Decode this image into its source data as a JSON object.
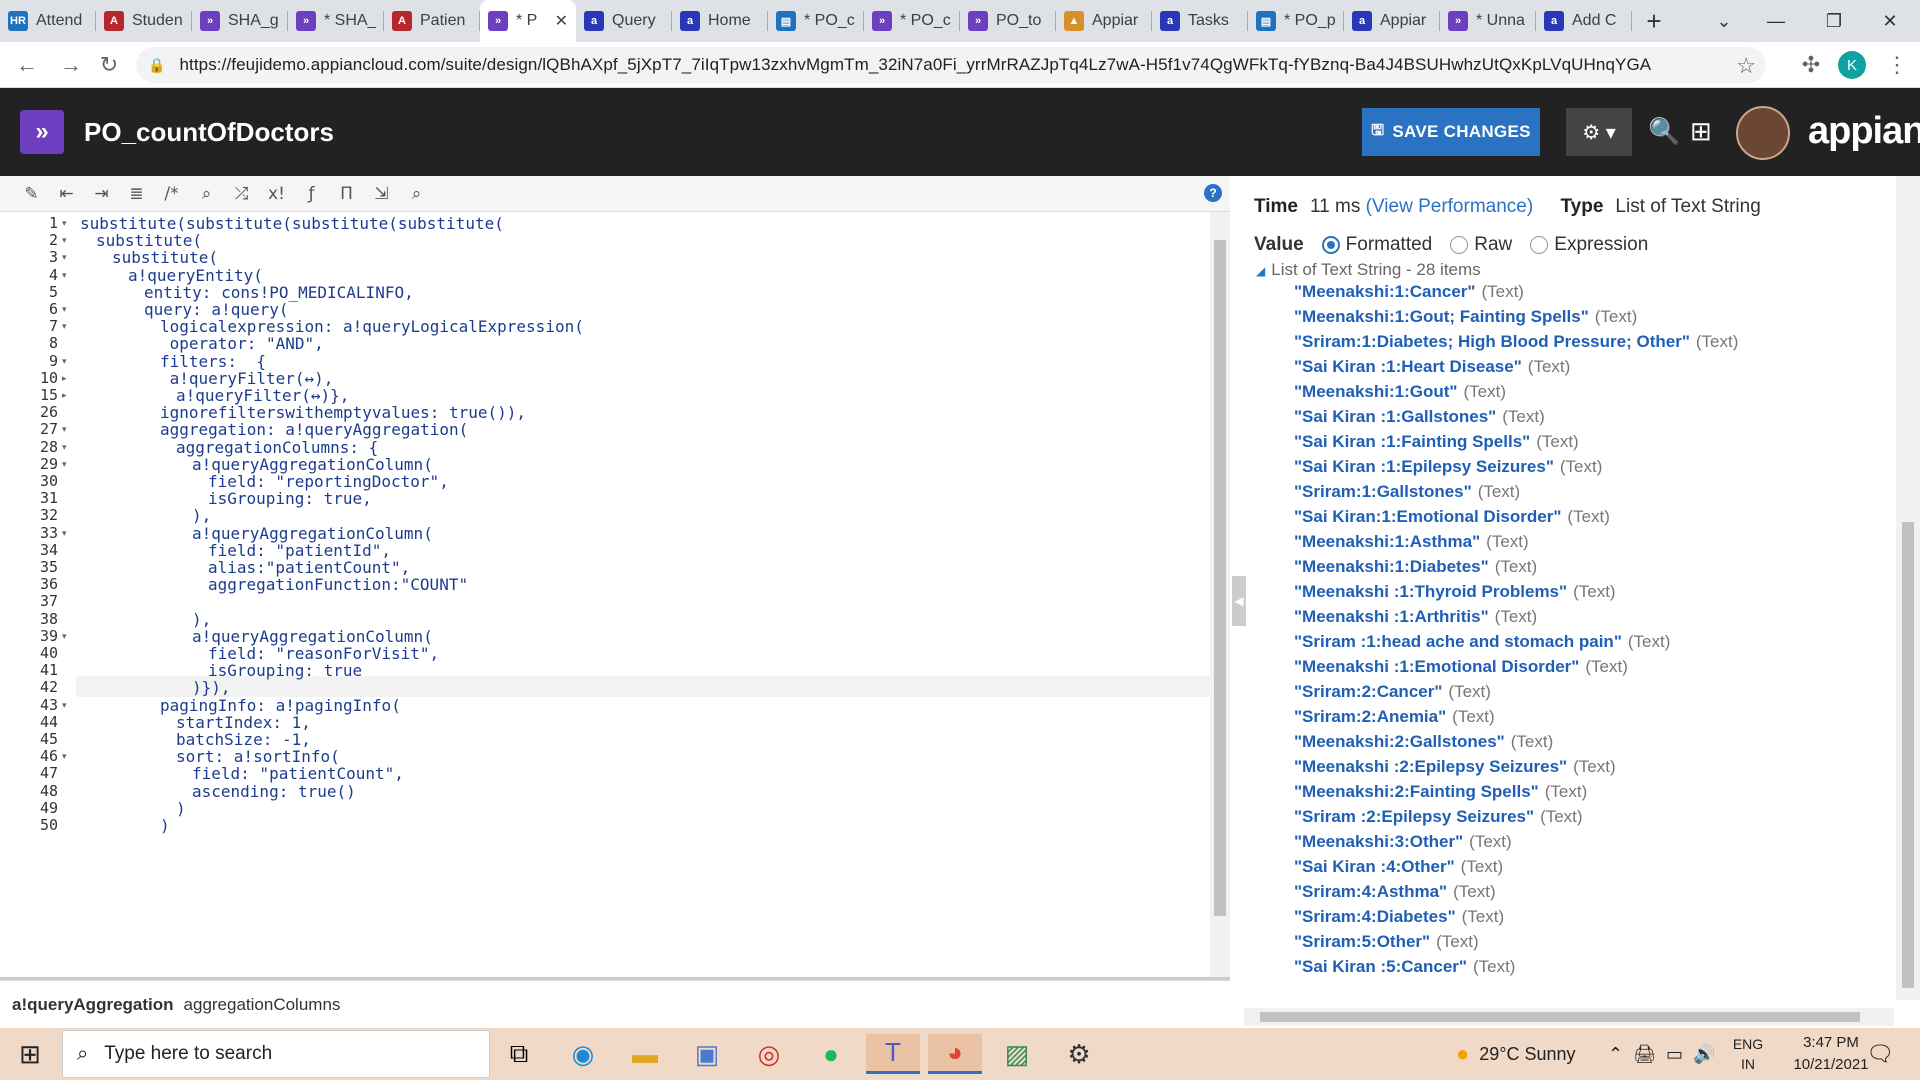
{
  "browser": {
    "tabs": [
      {
        "label": "Attend",
        "icon": "hr-icon",
        "color": "#1e73be",
        "glyph": "HR"
      },
      {
        "label": "Studen",
        "icon": "access-icon",
        "color": "#b7282e",
        "glyph": "A"
      },
      {
        "label": "SHA_g",
        "icon": "appian-icon",
        "color": "#6d3fc0",
        "glyph": "»"
      },
      {
        "label": "* SHA_",
        "icon": "appian-icon",
        "color": "#6d3fc0",
        "glyph": "»"
      },
      {
        "label": "Patien",
        "icon": "access-icon",
        "color": "#b7282e",
        "glyph": "A"
      },
      {
        "label": "* P",
        "icon": "appian-icon",
        "color": "#6d3fc0",
        "glyph": "»",
        "active": true
      },
      {
        "label": "Query",
        "icon": "appian-a-icon",
        "color": "#2a36b8",
        "glyph": "a"
      },
      {
        "label": "Home",
        "icon": "appian-a-icon",
        "color": "#2a36b8",
        "glyph": "a"
      },
      {
        "label": "* PO_c",
        "icon": "form-icon",
        "color": "#1e73be",
        "glyph": "▤"
      },
      {
        "label": "* PO_c",
        "icon": "appian-icon",
        "color": "#6d3fc0",
        "glyph": "»"
      },
      {
        "label": "PO_to",
        "icon": "appian-icon",
        "color": "#6d3fc0",
        "glyph": "»"
      },
      {
        "label": "Appiar",
        "icon": "pma-icon",
        "color": "#d98f2b",
        "glyph": "▲"
      },
      {
        "label": "Tasks",
        "icon": "appian-a-icon",
        "color": "#2a36b8",
        "glyph": "a"
      },
      {
        "label": "* PO_p",
        "icon": "form-icon",
        "color": "#1e73be",
        "glyph": "▤"
      },
      {
        "label": "Appiar",
        "icon": "appian-a-icon",
        "color": "#2a36b8",
        "glyph": "a"
      },
      {
        "label": "* Unna",
        "icon": "appian-icon",
        "color": "#6d3fc0",
        "glyph": "»"
      },
      {
        "label": "Add C",
        "icon": "appian-a-icon",
        "color": "#2a36b8",
        "glyph": "a"
      }
    ],
    "new_tab": "+",
    "url": "https://feujidemo.appiancloud.com/suite/design/lQBhAXpf_5jXpT7_7iIqTpw13zxhvMgmTm_32iN7a0Fi_yrrMrRAZJpTq4Lz7wA-H5f1v74QgWFkTq-fYBznq-Ba4J4BSUHwhzUtQxKpLVqUHnqYGA",
    "profile_initial": "K"
  },
  "app": {
    "title": "PO_countOfDoctors",
    "save_label": "SAVE CHANGES",
    "brand": "appian"
  },
  "editor": {
    "toolbar_icons": [
      "wand-icon",
      "outdent-icon",
      "indent-icon",
      "list-icon",
      "comment-icon",
      "search-icon",
      "shuffle-icon",
      "function-x-icon",
      "fx-icon",
      "text-icon",
      "export-icon",
      "search-db-icon"
    ],
    "lines": [
      {
        "n": "1",
        "fold": "▾",
        "indent": 0,
        "text": "substitute(substitute(substitute(substitute("
      },
      {
        "n": "2",
        "fold": "▾",
        "indent": 1,
        "text": "substitute("
      },
      {
        "n": "3",
        "fold": "▾",
        "indent": 2,
        "text": "substitute("
      },
      {
        "n": "4",
        "fold": "▾",
        "indent": 3,
        "text": "a!queryEntity("
      },
      {
        "n": "5",
        "fold": "",
        "indent": 4,
        "text": "entity: cons!PO_MEDICALINFO,"
      },
      {
        "n": "6",
        "fold": "▾",
        "indent": 4,
        "text": "query: a!query("
      },
      {
        "n": "7",
        "fold": "▾",
        "indent": 5,
        "text": "logicalexpression: a!queryLogicalExpression("
      },
      {
        "n": "8",
        "fold": "",
        "indent": 5,
        "text": " operator: \"AND\","
      },
      {
        "n": "9",
        "fold": "▾",
        "indent": 5,
        "text": "filters:  {"
      },
      {
        "n": "10",
        "fold": "▸",
        "indent": 5,
        "text": " a!queryFilter(↔),"
      },
      {
        "n": "15",
        "fold": "▸",
        "indent": 6,
        "text": "a!queryFilter(↔)},"
      },
      {
        "n": "26",
        "fold": "",
        "indent": 5,
        "text": "ignorefilterswithemptyvalues: true()),"
      },
      {
        "n": "27",
        "fold": "▾",
        "indent": 5,
        "text": "aggregation: a!queryAggregation("
      },
      {
        "n": "28",
        "fold": "▾",
        "indent": 6,
        "text": "aggregationColumns: {"
      },
      {
        "n": "29",
        "fold": "▾",
        "indent": 7,
        "text": "a!queryAggregationColumn("
      },
      {
        "n": "30",
        "fold": "",
        "indent": 8,
        "text": "field: \"reportingDoctor\","
      },
      {
        "n": "31",
        "fold": "",
        "indent": 8,
        "text": "isGrouping: true,"
      },
      {
        "n": "32",
        "fold": "",
        "indent": 7,
        "text": "),"
      },
      {
        "n": "33",
        "fold": "▾",
        "indent": 7,
        "text": "a!queryAggregationColumn("
      },
      {
        "n": "34",
        "fold": "",
        "indent": 8,
        "text": "field: \"patientId\","
      },
      {
        "n": "35",
        "fold": "",
        "indent": 8,
        "text": "alias:\"patientCount\","
      },
      {
        "n": "36",
        "fold": "",
        "indent": 8,
        "text": "aggregationFunction:\"COUNT\""
      },
      {
        "n": "37",
        "fold": "",
        "indent": 8,
        "text": ""
      },
      {
        "n": "38",
        "fold": "",
        "indent": 7,
        "text": "),"
      },
      {
        "n": "39",
        "fold": "▾",
        "indent": 7,
        "text": "a!queryAggregationColumn("
      },
      {
        "n": "40",
        "fold": "",
        "indent": 8,
        "text": "field: \"reasonForVisit\","
      },
      {
        "n": "41",
        "fold": "",
        "indent": 8,
        "text": "isGrouping: true"
      },
      {
        "n": "42",
        "fold": "",
        "indent": 7,
        "text": ")}),"
      },
      {
        "n": "43",
        "fold": "▾",
        "indent": 5,
        "text": "pagingInfo: a!pagingInfo("
      },
      {
        "n": "44",
        "fold": "",
        "indent": 6,
        "text": "startIndex: 1,"
      },
      {
        "n": "45",
        "fold": "",
        "indent": 6,
        "text": "batchSize: -1,"
      },
      {
        "n": "46",
        "fold": "▾",
        "indent": 6,
        "text": "sort: a!sortInfo("
      },
      {
        "n": "47",
        "fold": "",
        "indent": 7,
        "text": "field: \"patientCount\","
      },
      {
        "n": "48",
        "fold": "",
        "indent": 7,
        "text": "ascending: true()"
      },
      {
        "n": "49",
        "fold": "",
        "indent": 6,
        "text": ")"
      },
      {
        "n": "50",
        "fold": "",
        "indent": 5,
        "text": ")"
      }
    ],
    "active_line": "42",
    "breadcrumb_fn": "a!queryAggregation",
    "breadcrumb_param": "aggregationColumns"
  },
  "result": {
    "time_label": "Time",
    "time_value": "11 ms",
    "view_perf": "(View Performance)",
    "type_label": "Type",
    "type_value": "List of Text String",
    "value_label": "Value",
    "modes": [
      "Formatted",
      "Raw",
      "Expression"
    ],
    "selected_mode": "Formatted",
    "list_header": "List of Text String - 28 items",
    "item_type": "(Text)",
    "items": [
      "\"Meenakshi:1:Cancer\"",
      "\"Meenakshi:1:Gout; Fainting Spells\"",
      "\"Sriram:1:Diabetes; High Blood Pressure; Other\"",
      "\"Sai Kiran :1:Heart Disease\"",
      "\"Meenakshi:1:Gout\"",
      "\"Sai Kiran :1:Gallstones\"",
      "\"Sai Kiran :1:Fainting Spells\"",
      "\"Sai Kiran :1:Epilepsy Seizures\"",
      "\"Sriram:1:Gallstones\"",
      "\"Sai Kiran:1:Emotional Disorder\"",
      "\"Meenakshi:1:Asthma\"",
      "\"Meenakshi:1:Diabetes\"",
      "\"Meenakshi :1:Thyroid Problems\"",
      "\"Meenakshi :1:Arthritis\"",
      "\"Sriram :1:head ache and stomach pain\"",
      "\"Meenakshi :1:Emotional Disorder\"",
      "\"Sriram:2:Cancer\"",
      "\"Sriram:2:Anemia\"",
      "\"Meenakshi:2:Gallstones\"",
      "\"Meenakshi :2:Epilepsy Seizures\"",
      "\"Meenakshi:2:Fainting Spells\"",
      "\"Sriram :2:Epilepsy Seizures\"",
      "\"Meenakshi:3:Other\"",
      "\"Sai Kiran :4:Other\"",
      "\"Sriram:4:Asthma\"",
      "\"Sriram:4:Diabetes\"",
      "\"Sriram:5:Other\"",
      "\"Sai Kiran :5:Cancer\""
    ]
  },
  "taskbar": {
    "search_placeholder": "Type here to search",
    "weather": "29°C  Sunny",
    "lang_1": "ENG",
    "lang_2": "IN",
    "time": "3:47 PM",
    "date": "10/21/2021"
  }
}
